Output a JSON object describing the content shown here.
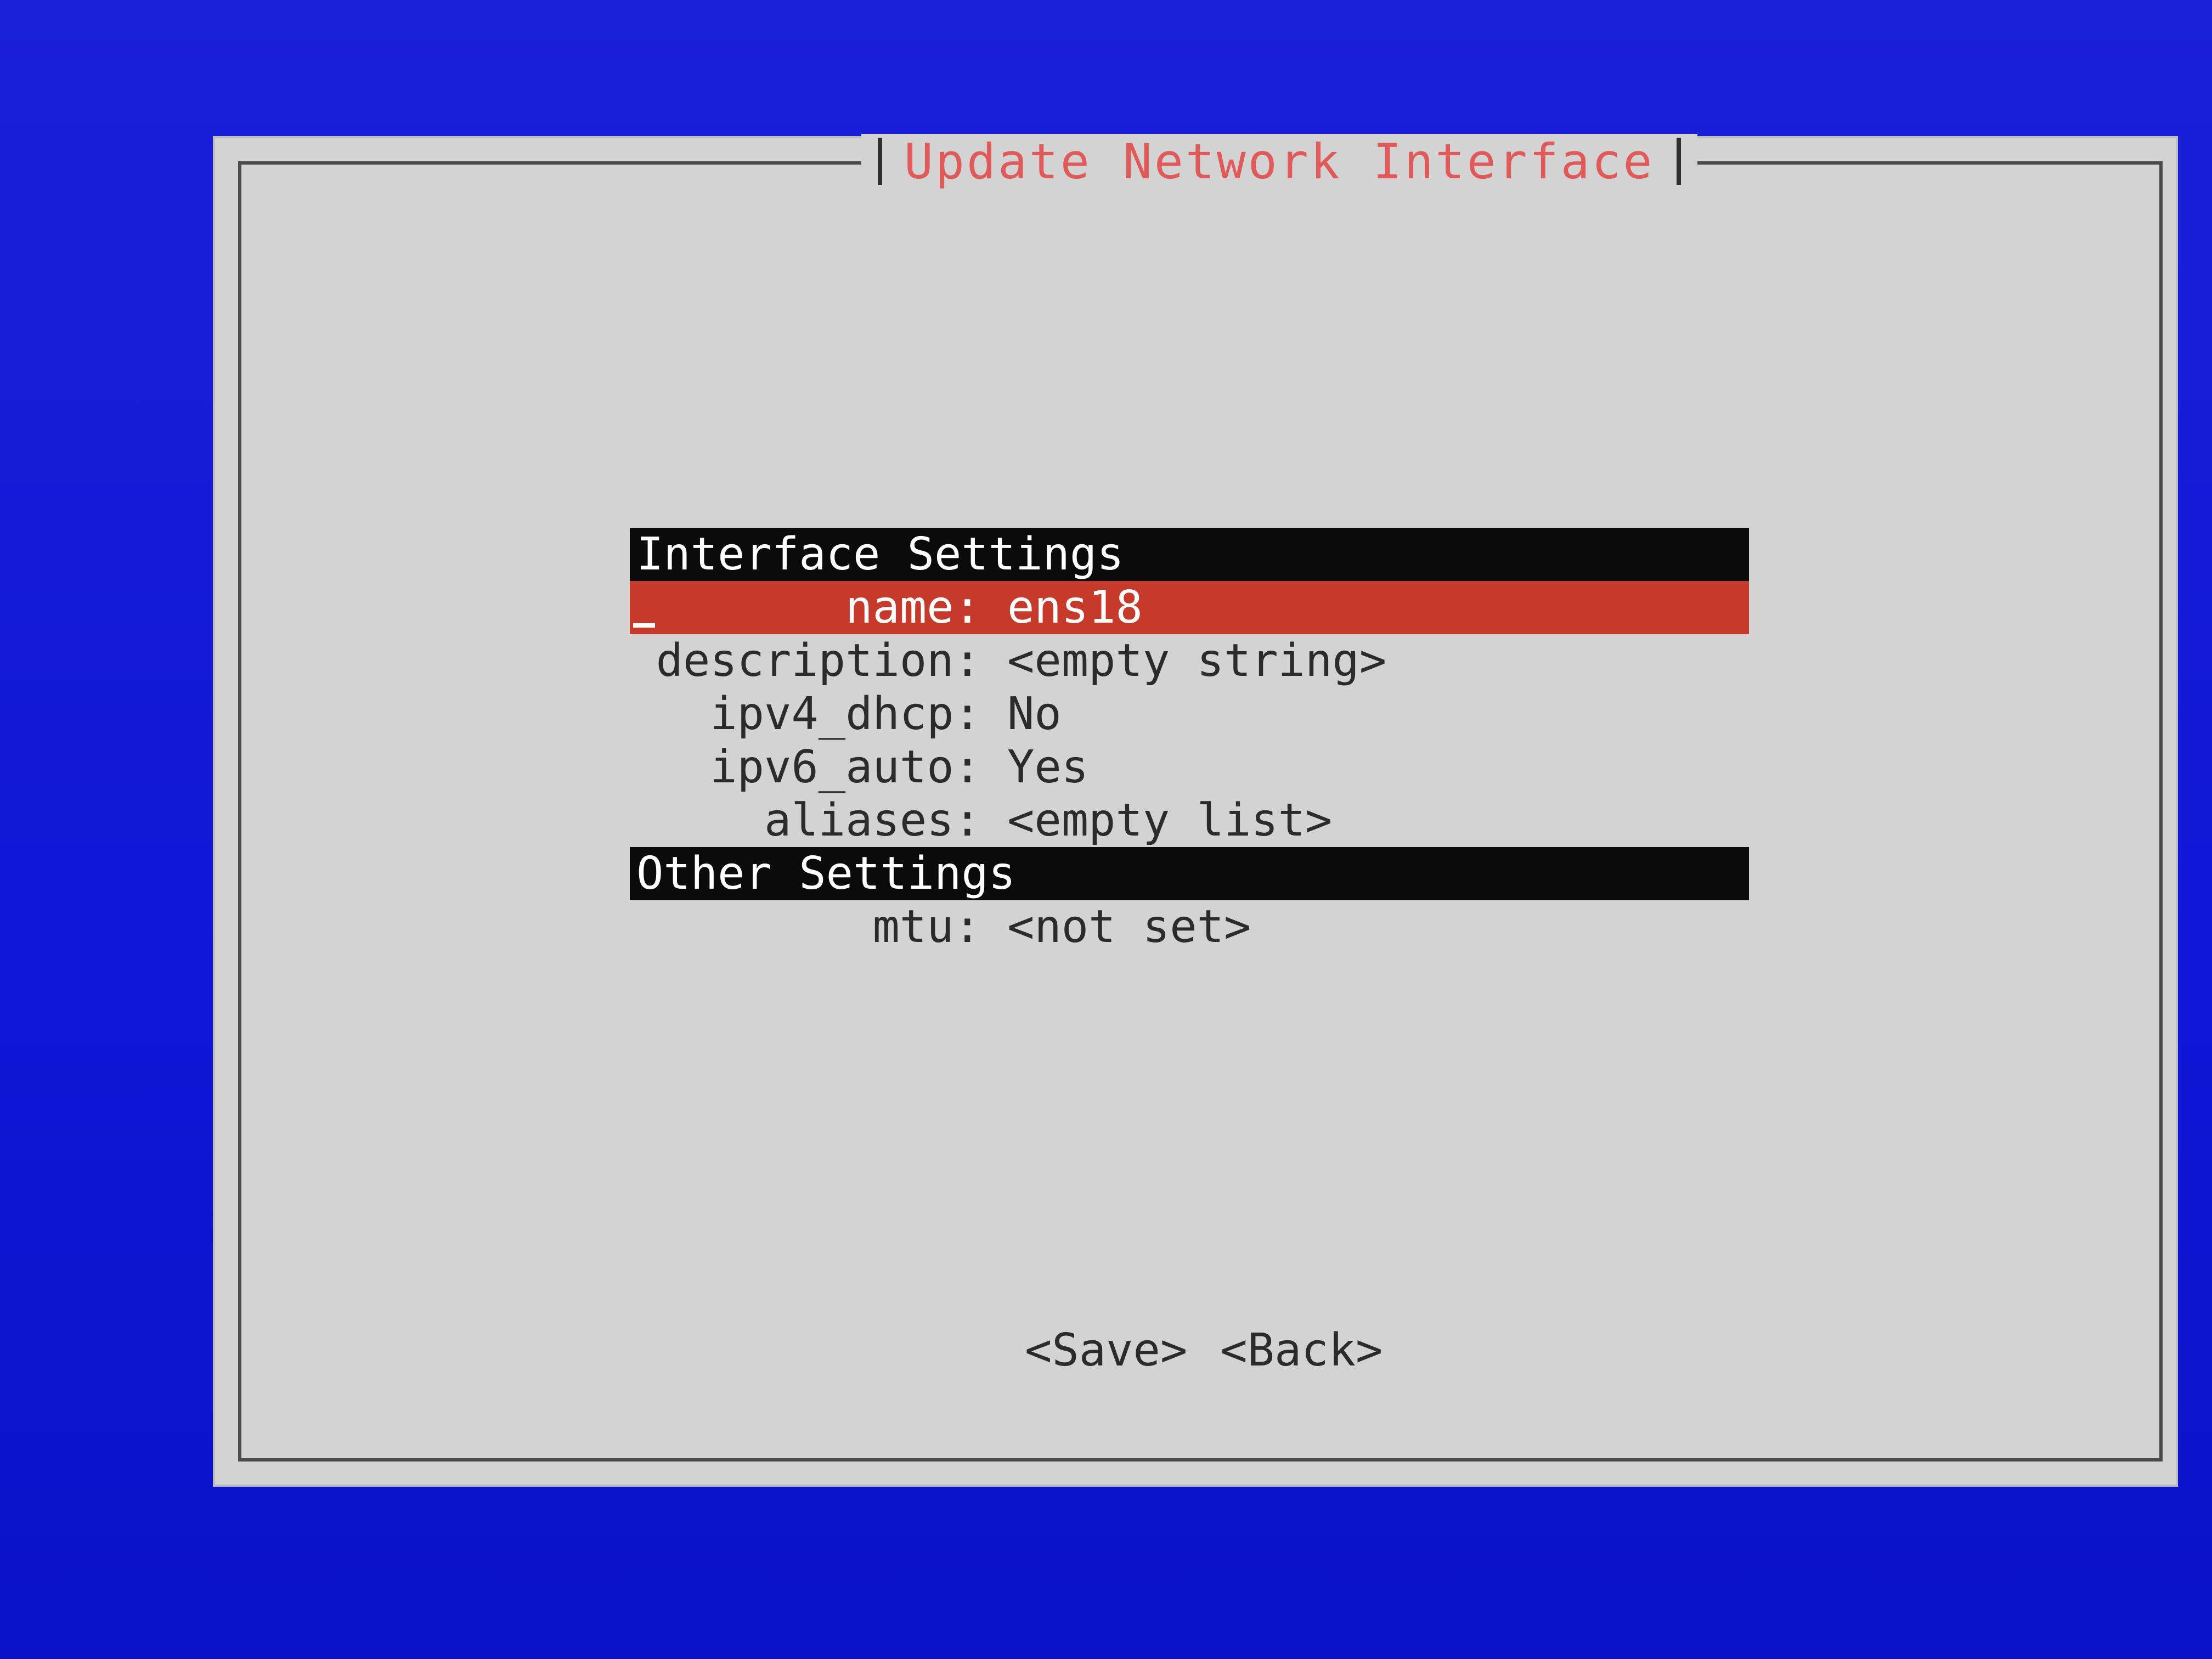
{
  "dialog": {
    "title": "Update Network Interface"
  },
  "sections": {
    "interface_title": "Interface Settings",
    "other_title": "Other Settings"
  },
  "fields": [
    {
      "label": "name:",
      "value": "ens18"
    },
    {
      "label": "description:",
      "value": "<empty string>"
    },
    {
      "label": "ipv4_dhcp:",
      "value": "No"
    },
    {
      "label": "ipv6_auto:",
      "value": "Yes"
    },
    {
      "label": "aliases:",
      "value": "<empty list>"
    },
    {
      "label": "mtu:",
      "value": "<not set>"
    }
  ],
  "buttons": {
    "save": "<Save>",
    "back": "<Back>"
  },
  "colors": {
    "background": "#0f16d6",
    "dialog": "#d3d3d3",
    "title": "#e05a5a",
    "selection": "#c63a2c",
    "section": "#0b0b0b"
  }
}
